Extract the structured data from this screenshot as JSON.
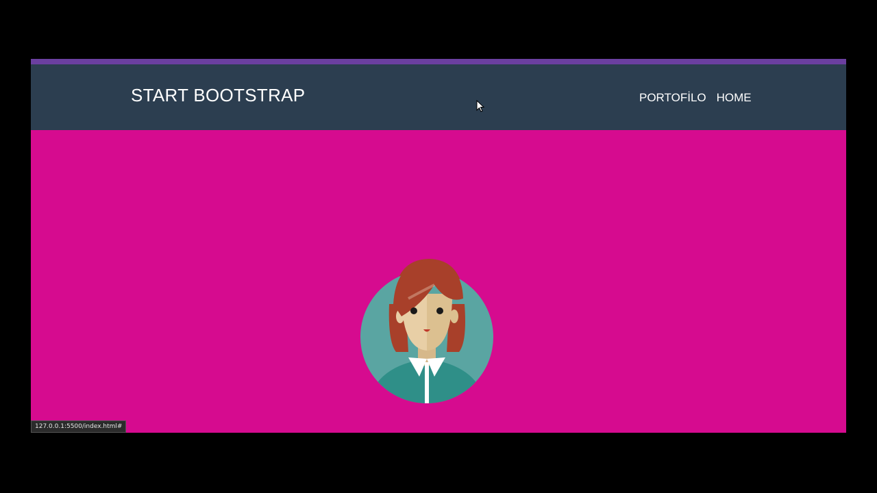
{
  "navbar": {
    "brand": "START BOOTSTRAP",
    "links": [
      {
        "label": "PORTOFİLO"
      },
      {
        "label": "HOME"
      }
    ]
  },
  "hero": {
    "avatar_icon": "woman-avatar-icon"
  },
  "status_bar": {
    "url": "127.0.0.1:5500/index.html#"
  },
  "colors": {
    "accent_bar": "#6b3fa0",
    "navbar_bg": "#2c3e50",
    "hero_bg": "#d60b8f",
    "avatar_circle": "#5aa5a2",
    "hair": "#a8402a",
    "skin": "#e8cfa6",
    "shirt": "#2f8f88"
  }
}
